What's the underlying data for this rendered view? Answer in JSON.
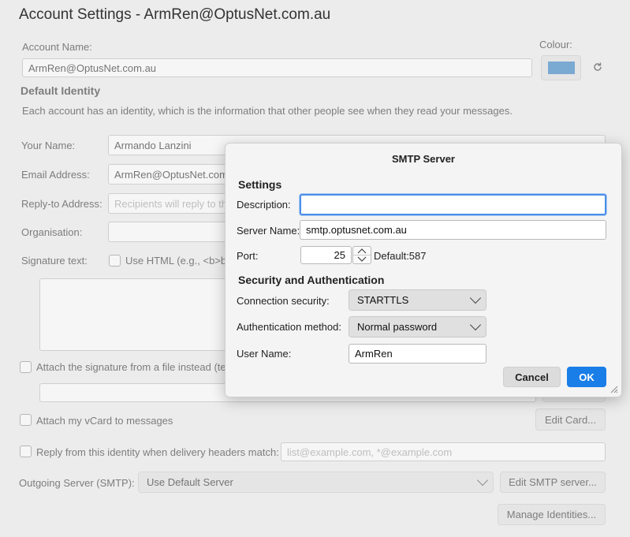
{
  "page": {
    "title": "Account Settings - ArmRen@OptusNet.com.au",
    "account_name_label": "Account Name:",
    "account_name_value": "ArmRen@OptusNet.com.au",
    "colour_label": "Colour:",
    "colour_value": "#1e73be",
    "reset_colour_icon": "reset-icon",
    "default_identity_heading": "Default Identity",
    "identity_description": "Each account has an identity, which is the information that other people see when they read your messages.",
    "your_name_label": "Your Name:",
    "your_name_value": "Armando Lanzini",
    "email_label": "Email Address:",
    "email_value": "ArmRen@OptusNet.com.",
    "reply_to_label": "Reply-to Address:",
    "reply_to_placeholder": "Recipients will reply to th",
    "organisation_label": "Organisation:",
    "signature_label": "Signature text:",
    "use_html_label": "Use HTML (e.g., <b>b",
    "attach_signature_label": "Attach the signature from a file instead (te",
    "attach_vcard_label": "Attach my vCard to messages",
    "edit_card_button": "Edit Card...",
    "reply_from_label": "Reply from this identity when delivery headers match:",
    "reply_from_placeholder": "list@example.com, *@example.com",
    "outgoing_server_label": "Outgoing Server (SMTP):",
    "outgoing_server_value": "Use Default Server",
    "edit_smtp_button": "Edit SMTP server...",
    "manage_identities_button": "Manage Identities..."
  },
  "dialog": {
    "title": "SMTP Server",
    "settings_heading": "Settings",
    "description_label": "Description:",
    "description_value": "",
    "server_name_label": "Server Name:",
    "server_name_value": "smtp.optusnet.com.au",
    "port_label": "Port:",
    "port_value": "25",
    "port_default": "Default:587",
    "security_heading": "Security and Authentication",
    "connection_security_label": "Connection security:",
    "connection_security_value": "STARTTLS",
    "auth_method_label": "Authentication method:",
    "auth_method_value": "Normal password",
    "user_name_label": "User Name:",
    "user_name_value": "ArmRen",
    "cancel_button": "Cancel",
    "ok_button": "OK",
    "accent_color": "#1a7ee8"
  }
}
